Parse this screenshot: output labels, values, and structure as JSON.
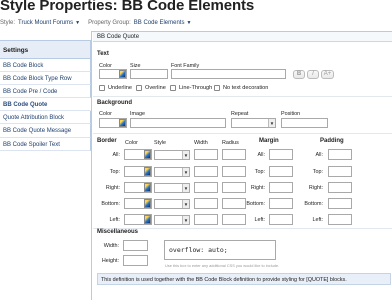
{
  "page": {
    "title": "Style Properties: BB Code Elements"
  },
  "filters": {
    "style_label": "Style:",
    "style_value": "Truck Mount Forums",
    "group_label": "Property Group:",
    "group_value": "BB Code Elements"
  },
  "sidebar": {
    "heading": "Settings",
    "items": [
      {
        "label": "BB Code Block"
      },
      {
        "label": "BB Code Block Type Row"
      },
      {
        "label": "BB Code Pre / Code"
      },
      {
        "label": "BB Code Quote"
      },
      {
        "label": "Quote Attribution Block"
      },
      {
        "label": "BB Code Quote Message"
      },
      {
        "label": "BB Code Spoiler Text"
      }
    ],
    "active_index": 3
  },
  "tab": {
    "label": "BB Code Quote"
  },
  "text_section": {
    "heading": "Text",
    "color_label": "Color",
    "size_label": "Size",
    "font_family_label": "Font Family",
    "format_buttons": [
      "B",
      "I",
      "A+"
    ],
    "checkboxes": [
      "Underline",
      "Overline",
      "Line-Through",
      "No text decoration"
    ]
  },
  "background_section": {
    "heading": "Background",
    "color_label": "Color",
    "image_label": "Image",
    "repeat_label": "Repeat",
    "position_label": "Position"
  },
  "border_section": {
    "heading": "Border",
    "color_label": "Color",
    "style_label": "Style",
    "width_label": "Width",
    "radius_label": "Radius",
    "margin_heading": "Margin",
    "padding_heading": "Padding",
    "rows": [
      "All:",
      "Top:",
      "Right:",
      "Bottom:",
      "Left:"
    ]
  },
  "misc_section": {
    "heading": "Miscellaneous",
    "width_label": "Width:",
    "height_label": "Height:",
    "css_value": "overflow: auto;",
    "hint": "Use this box to enter any additional CSS you would like to include."
  },
  "note": "This definition is used together with the BB Code Block definition to provide styling for [QUOTE] blocks."
}
